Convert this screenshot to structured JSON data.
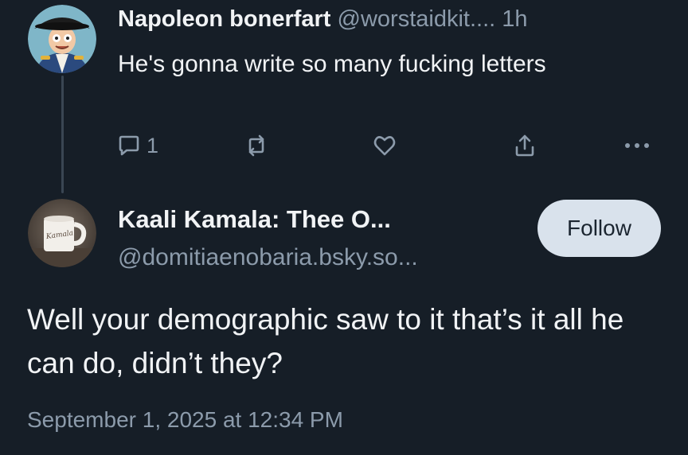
{
  "parent_post": {
    "display_name": "Napoleon bonerfart",
    "handle": "@worstaidkit....",
    "time": "1h",
    "text": "He's gonna write so many fucking letters",
    "reply_count": "1",
    "icons": [
      "comment-icon",
      "repost-icon",
      "heart-icon",
      "share-icon",
      "more-icon"
    ]
  },
  "reply_post": {
    "display_name": "Kaali Kamala: Thee O...",
    "handle": "@domitiaenobaria.bsky.so...",
    "follow_label": "Follow",
    "text": "Well your demographic saw to it that’s it all he can do, didn’t they?",
    "timestamp": "September 1, 2025 at 12:34 PM",
    "mug_text": "Kamala"
  },
  "colors": {
    "background": "#161e27",
    "text_primary": "#f1f3f5",
    "text_secondary": "#8c9bab",
    "follow_bg": "#d9e2ec",
    "thread_line": "#3a4653"
  }
}
